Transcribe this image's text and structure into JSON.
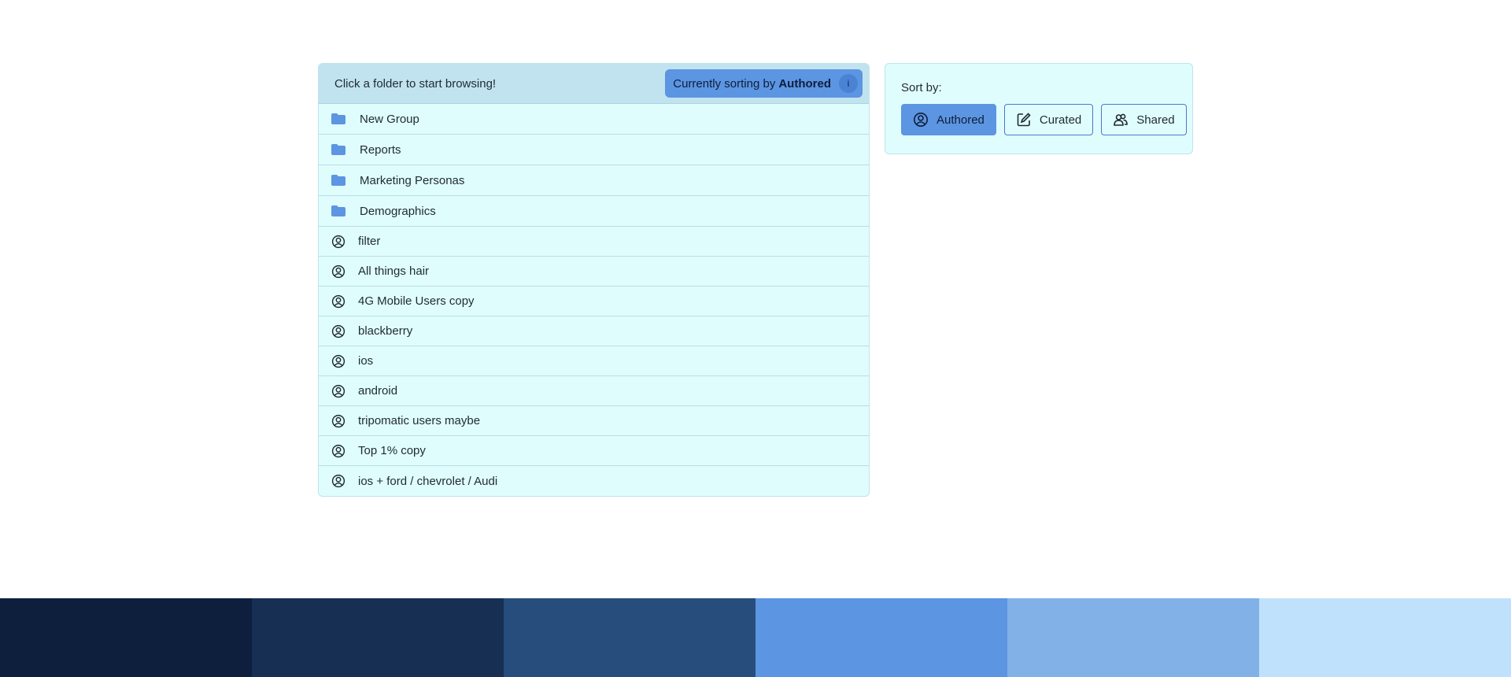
{
  "browser": {
    "hint": "Click a folder to start browsing!",
    "sort_prefix": "Currently sorting by",
    "sort_value": "Authored",
    "info_glyph": "i",
    "folders": [
      {
        "label": "New Group",
        "icon": "folder-icon"
      },
      {
        "label": "Reports",
        "icon": "folder-icon"
      },
      {
        "label": "Marketing Personas",
        "icon": "folder-icon"
      },
      {
        "label": "Demographics",
        "icon": "folder-icon"
      }
    ],
    "segments": [
      {
        "label": "filter",
        "icon": "user-circle-icon"
      },
      {
        "label": "All things hair",
        "icon": "user-circle-icon"
      },
      {
        "label": "4G Mobile Users copy",
        "icon": "user-circle-icon"
      },
      {
        "label": "blackberry",
        "icon": "user-circle-icon"
      },
      {
        "label": "ios",
        "icon": "user-circle-icon"
      },
      {
        "label": "android",
        "icon": "user-circle-icon"
      },
      {
        "label": "tripomatic users maybe",
        "icon": "user-circle-icon"
      },
      {
        "label": "Top 1% copy",
        "icon": "user-circle-icon"
      },
      {
        "label": "ios + ford / chevrolet / Audi",
        "icon": "user-circle-icon"
      }
    ]
  },
  "sort_panel": {
    "title": "Sort by:",
    "buttons": [
      {
        "label": "Authored",
        "icon": "user-circle-icon",
        "active": true
      },
      {
        "label": "Curated",
        "icon": "edit-icon",
        "active": false
      },
      {
        "label": "Shared",
        "icon": "users-icon",
        "active": false
      }
    ]
  },
  "palette": [
    "#0e1e3d",
    "#162f52",
    "#264d7c",
    "#5c95e1",
    "#82b1e8",
    "#c0e1fb"
  ]
}
